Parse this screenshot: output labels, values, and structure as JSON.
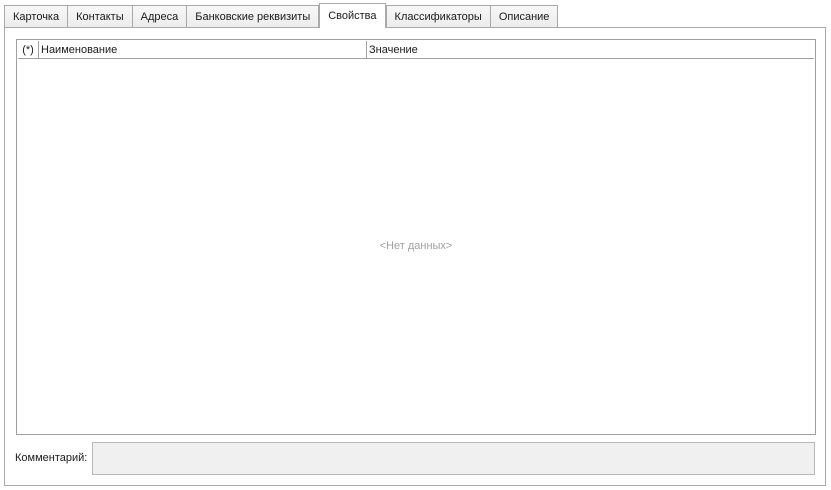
{
  "tabs": [
    {
      "label": "Карточка",
      "active": false
    },
    {
      "label": "Контакты",
      "active": false
    },
    {
      "label": "Адреса",
      "active": false
    },
    {
      "label": "Банковские реквизиты",
      "active": false
    },
    {
      "label": "Свойства",
      "active": true
    },
    {
      "label": "Классификаторы",
      "active": false
    },
    {
      "label": "Описание",
      "active": false
    }
  ],
  "grid": {
    "columns": {
      "indicator": "(*)",
      "name": "Наименование",
      "value": "Значение"
    },
    "rows": [],
    "empty_text": "<Нет данных>"
  },
  "comment": {
    "label": "Комментарий:",
    "value": ""
  }
}
